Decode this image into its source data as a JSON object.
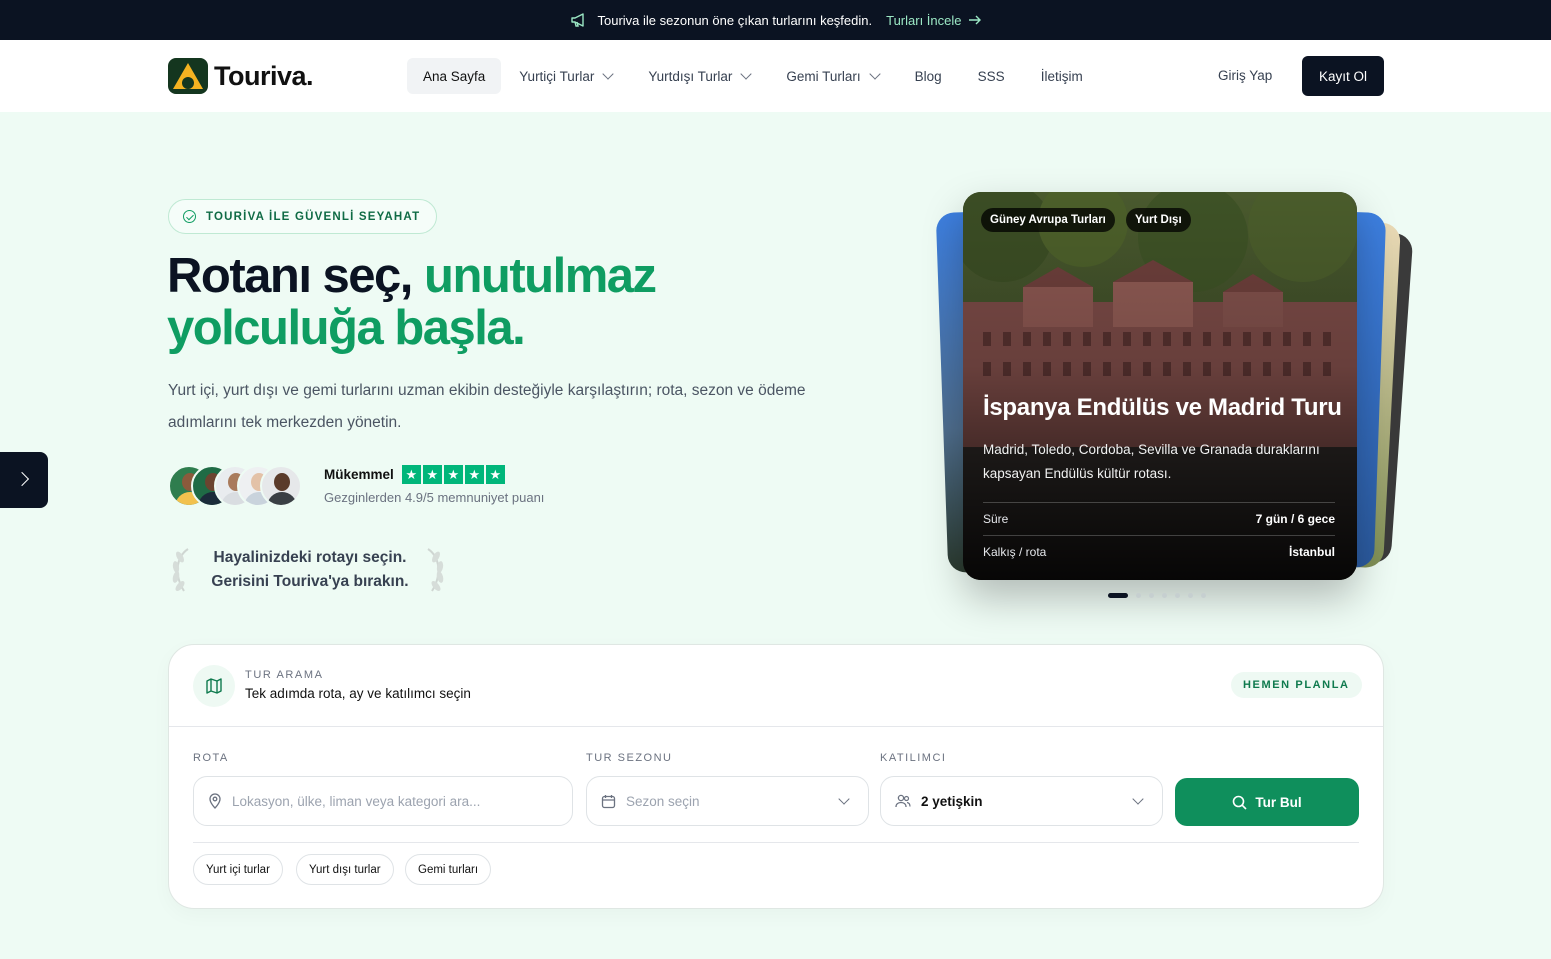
{
  "announcement": {
    "text": "Touriva ile sezonun öne çıkan turlarını keşfedin.",
    "link": "Turları İncele"
  },
  "brand": {
    "name": "Touriva."
  },
  "nav": {
    "items": [
      {
        "label": "Ana Sayfa",
        "active": true,
        "dropdown": false
      },
      {
        "label": "Yurtiçi Turlar",
        "dropdown": true
      },
      {
        "label": "Yurtdışı Turlar",
        "dropdown": true
      },
      {
        "label": "Gemi Turları",
        "dropdown": true
      },
      {
        "label": "Blog",
        "dropdown": false
      },
      {
        "label": "SSS",
        "dropdown": false
      },
      {
        "label": "İletişim",
        "dropdown": false
      }
    ],
    "login": "Giriş Yap",
    "register": "Kayıt Ol"
  },
  "hero": {
    "badge": "TOURİVA İLE GÜVENLİ SEYAHAT",
    "headline_dark": "Rotanı seç,",
    "headline_green_1": "unutulmaz",
    "headline_green_2": "yolculuğa başla.",
    "description": "Yurt içi, yurt dışı ve gemi turlarını uzman ekibin desteğiyle karşılaştırın; rota, sezon ve ödeme adımlarını tek merkezden yönetin.",
    "rating_label": "Mükemmel",
    "rating_stars": 5,
    "rating_sub": "Gezginlerden 4.9/5 memnuniyet puanı",
    "quote_line1": "Hayalinizdeki rotayı seçin.",
    "quote_line2": "Gerisini Touriva'ya bırakın."
  },
  "tour_card": {
    "tags": [
      "Güney Avrupa Turları",
      "Yurt Dışı"
    ],
    "title": "İspanya Endülüs ve Madrid Turu",
    "description": "Madrid, Toledo, Cordoba, Sevilla ve Granada duraklarını kapsayan Endülüs kültür rotası.",
    "rows": [
      {
        "label": "Süre",
        "value": "7 gün / 6 gece"
      },
      {
        "label": "Kalkış / rota",
        "value": "İstanbul"
      }
    ],
    "carousel_count": 7,
    "carousel_active": 1
  },
  "search": {
    "kicker": "TUR ARAMA",
    "title": "Tek adımda rota, ay ve katılımcı seçin",
    "plan_badge": "HEMEN PLANLA",
    "route_label": "ROTA",
    "route_placeholder": "Lokasyon, ülke, liman veya kategori ara...",
    "season_label": "TUR SEZONU",
    "season_placeholder": "Sezon seçin",
    "participants_label": "KATILIMCI",
    "participants_value": "2 yetişkin",
    "find_button": "Tur Bul",
    "quick_filters": [
      "Yurt içi turlar",
      "Yurt dışı turlar",
      "Gemi turları"
    ]
  },
  "colors": {
    "brand_green": "#0f9d62",
    "dark": "#0b1322",
    "background": "#eefbf4",
    "trustpilot": "#00b67a"
  }
}
